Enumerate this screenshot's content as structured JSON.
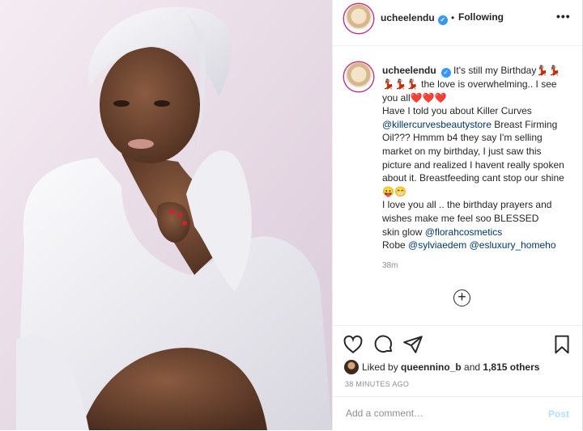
{
  "post": {
    "username": "ucheelendu",
    "follow_separator": "•",
    "follow_label": "Following",
    "more_label": "•••"
  },
  "caption": {
    "username": "ucheelendu",
    "text_1": "It's still my Birthday💃🏽💃🏽💃🏽💃🏽💃🏽 the love is overwhelming.. I see you all❤️❤️❤️",
    "text_2": "Have I told you about Killer Curves",
    "mention_1": "@killercurvesbeautystore",
    "text_3": " Breast Firming Oil??? Hmmm b4 they say I'm selling market on my birthday, I just saw this picture and realized I havent really spoken about it. Breastfeeding cant stop our shine😛😁",
    "text_4": "I love you all .. the birthday prayers and wishes make me feel soo BLESSED",
    "text_5": "skin glow ",
    "mention_2": "@florahcosmetics",
    "text_6": "Robe ",
    "mention_3": "@sylviaedem",
    "mention_4": "@esluxury_homeho",
    "time": "38m"
  },
  "load_more_label": "+",
  "likes": {
    "prefix": "Liked by ",
    "user": "queennino_b",
    "middle": " and ",
    "others": "1,815 others"
  },
  "timestamp": "38 MINUTES AGO",
  "comment_box": {
    "placeholder": "Add a comment…",
    "post_label": "Post"
  },
  "colors": {
    "link": "#00376b",
    "verified": "#3897f0",
    "post_disabled": "#b2dffc",
    "muted": "#8e8e8e"
  },
  "icons": [
    "heart-icon",
    "comment-icon",
    "share-icon",
    "bookmark-icon",
    "add-circle-icon",
    "verified-badge-icon"
  ]
}
